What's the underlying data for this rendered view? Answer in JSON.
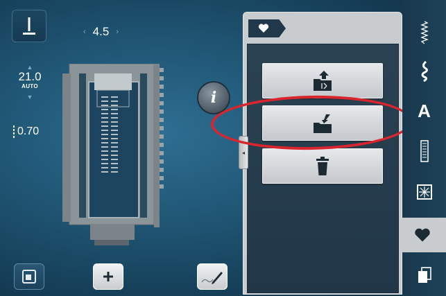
{
  "stitch_width": {
    "value": "4.5",
    "left_arrow": "‹",
    "right_arrow": "›"
  },
  "stitch_length": {
    "up": "▲",
    "value": "21.0",
    "mode": "AUTO",
    "down": "▼"
  },
  "tension": {
    "icon": "needle-position-icon",
    "value": "0.70"
  },
  "info_button": {
    "label": "i"
  },
  "panel": {
    "tab_icon": "heart-icon",
    "buttons": [
      {
        "name": "save-to-folder",
        "icon": "folder-upload-icon"
      },
      {
        "name": "load-from-folder",
        "icon": "folder-download-icon"
      },
      {
        "name": "delete",
        "icon": "trash-icon"
      }
    ],
    "handle_arrow": "◂"
  },
  "sidebar": {
    "items": [
      {
        "name": "practical-stitches",
        "icon": "zigzag-stitch-icon"
      },
      {
        "name": "decorative-stitches",
        "icon": "decorative-stitch-icon"
      },
      {
        "name": "alphabets",
        "label": "A"
      },
      {
        "name": "buttonholes",
        "icon": "buttonhole-icon"
      },
      {
        "name": "quilt-stitches",
        "icon": "quilt-icon"
      },
      {
        "name": "personal-program",
        "icon": "heart-icon"
      },
      {
        "name": "memory",
        "icon": "pages-icon"
      }
    ],
    "active": "personal-program"
  },
  "bottom_buttons": [
    {
      "name": "presser-foot-indicator",
      "icon": "square-icon"
    },
    {
      "name": "add-button",
      "icon": "plus-icon"
    },
    {
      "name": "stitch-editor",
      "icon": "pen-line-icon"
    }
  ],
  "colors": {
    "background": "#1f5573",
    "panel": "#c9ccce",
    "panel_inner": "#253c4d",
    "highlight": "#d9262e"
  }
}
